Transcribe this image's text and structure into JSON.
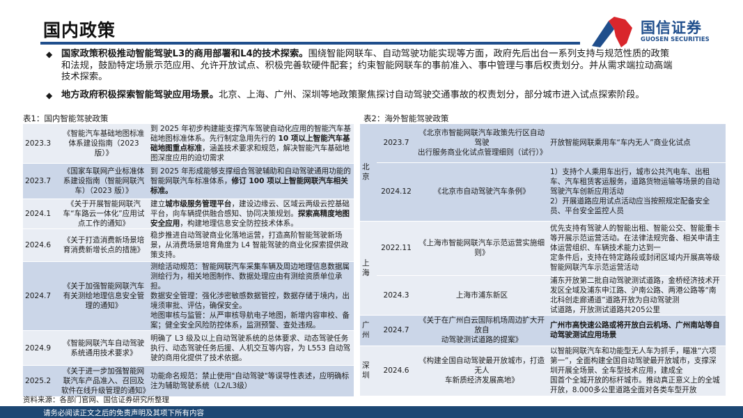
{
  "header": {
    "title": "国内政策",
    "logo_cn": "国信证券",
    "logo_en": "GUOSEN SECURITIES",
    "brand_blue": "#1f4e8c",
    "brand_red": "#d9262c"
  },
  "bullets": [
    {
      "bold": "国家政策积极推动智能驾驶L3的商用部署和L4的技术探索。",
      "text": "围绕智能网联车、自动驾驶功能实现等方面，政府先后出台一系列支持与规范性质的政策和法规，鼓励特定场景示范应用、允许开放试点、积极完善软硬件配套；约束智能网联车的事前准入、事中管理与事后权责划分。并从需求端拉动高端技术探索。"
    },
    {
      "bold": "地方政府积极探索智能驾驶应用场景。",
      "text": "北京、上海、广州、深圳等地政策聚焦探讨自动驾驶交通事故的权责划分，部分城市进入试点探索阶段。"
    }
  ],
  "table1": {
    "caption": "表1：国内智能驾驶政策",
    "rows": [
      {
        "date": "2023.3",
        "name": "《智能汽车基础地图标准体系建设指南（2023 版）》",
        "desc": [
          {
            "t": "到 2025 年初步构建能支撑汽车驾驶自动化应用的智能汽车基础地图标准体系。先行制定急用先行的 "
          },
          {
            "t": "10 项以上智能汽车基础地图重点标准",
            "b": true
          },
          {
            "t": "，涵盖技术要求和规范，解决智能汽车基础地图深度应用的迫切需求"
          }
        ]
      },
      {
        "date": "2023.7",
        "name": "《国家车联网产业标准体系建设指南（智能网联汽车）（2023 版）》",
        "desc": [
          {
            "t": "到 2025 年形成能够支撑组合驾驶辅助和自动驾驶通用功能的智能网联汽车标准体系，"
          },
          {
            "t": "修订 100 项以上智能网联汽车相关标准。",
            "b": true
          }
        ]
      },
      {
        "date": "2024.1",
        "name": "《关于开展智能网联汽车“车路云一体化”应用试点工作的通知》",
        "desc": [
          {
            "t": "建立"
          },
          {
            "t": "城市级服务管理平台",
            "b": true
          },
          {
            "t": "，建设边缘云、区域云两级云控基础平台，向车辆提供融合感知、协同决策规划。"
          },
          {
            "t": "探索高精度地图安全应用",
            "b": true
          },
          {
            "t": "，构建地理信息安全防控技术体系。"
          }
        ]
      },
      {
        "date": "2024.6",
        "name": "《关于打造消费新场景培育消费新增长点的措施》",
        "desc": [
          {
            "t": "稳步推进自动驾驶商业化落地运营，打造高阶智能驾驶新场景，从消费场景培育角度为 L4 智能驾驶的商业化探索提供政策支持。"
          }
        ]
      },
      {
        "date": "2024.7",
        "name": "《关于加强智能网联汽车有关测绘地理信息安全管理的通知》",
        "desc": [
          {
            "t": "测绘活动规范：智能网联汽车采集车辆及周边地理信息数据属测绘行为，相关地图制作、数据处理应由有测绘资质单位承担。\n数据安全管理：强化涉密敏感数据管控，数据存储于境内，出境须审批、评估，确保安全。\n地图审核与监管：从严审核导航电子地图，新增内容审校、备案；健全安全风险防控体系，监测预警、查处违规。"
          }
        ]
      },
      {
        "date": "2024.9",
        "name": "《智能网联汽车自动驾驶系统通用技术要求》",
        "desc": [
          {
            "t": "明确了 L3 级及以上自动驾驶系统的总体要求、动态驾驶任务执行、动态驾驶任务后援、人机交互等内容，为 L553 自动驾驶的商用化提供了技术依据。"
          }
        ]
      },
      {
        "date": "2025.2",
        "name": "《关于进一步加强智能网联汽车产品准入、召回及软件在线升级管理的通知》",
        "desc": [
          {
            "t": "功能命名规范：禁止使用\"自动驾驶\"等误导性表述，应明确标注为辅助驾驶系统（L2/L3级）"
          }
        ]
      }
    ],
    "source": "资料来源：各部门官网、国信证券研究所整理"
  },
  "table2": {
    "caption": "表2：海外智能驾驶政策",
    "groups": [
      {
        "city": "北京",
        "rows": [
          {
            "date": "2023.7",
            "name": "《北京市智能网联汽车政策先行区自动驾驶\n出行服务商业化试点管理细则（试行）》",
            "desc": [
              {
                "t": "开放智能网联乘用车“车内无人”商业化试点"
              }
            ]
          },
          {
            "date": "2024.12",
            "name": "《北京市自动驾驶汽车条例》",
            "desc": [
              {
                "t": "1）支持个人乘用车出行，城市公共汽电车、出租车、汽车租赁客运服务，道路货物运输等场景的自动驾驶汽车创新应用活动\n2）开展道路应用试点活动应当按照规定配备安全员、平台安全监控人员"
              }
            ]
          }
        ]
      },
      {
        "city": "上海",
        "rows": [
          {
            "date": "2022.11",
            "name": "《上海市智能网联汽车示范运营实施细则》",
            "desc": [
              {
                "t": "优先支持有驾驶人的智能出租、智能公交、智能重卡等开展示范运营活动。在法律法规完备、相关申请主体运营组织、车辆技术能力达到一\n定条件后，支持在特定路段或封闭区域内开展高等级智能网联汽车示范运营活动"
              }
            ]
          },
          {
            "date": "2024.3",
            "name": "上海市浦东新区",
            "desc": [
              {
                "t": "浦东开放第二批自动驾驶测试道路，金桥经济技术开发区全域及浦东申江路、沪南公路、两港公路等“南北科创走廊通道”道路开放为自动驾驶测\n试道路，开放测试道路共205公里"
              }
            ]
          }
        ]
      },
      {
        "city": "广州",
        "rows": [
          {
            "date": "2024.7",
            "name": "《关于在广州白云国际机场周边扩大开放自\n动驾驶测试道路的提案》",
            "desc": [
              {
                "t": "广州市高快速公路或将开放白云机场、广州南站等自动驾驶测试应用场景",
                "b": true
              }
            ]
          }
        ]
      },
      {
        "city": "深圳",
        "rows": [
          {
            "date": "2024.6",
            "name": "《构建全国自动驾驶最开放城市，打造无人\n车新质经济发展高地》",
            "desc": [
              {
                "t": "以智能网联汽车和功能型无人车为抓手，瞄准“六项第一”，全面构建全国自动驾驶最开放城市，支撑深圳开展全场景、全车型技术应用，建成全\n国首个全城开放的标杆城市。推动真正意义上的全城开放，8.000多公里道路全面对各类车型开放"
              }
            ]
          }
        ]
      }
    ]
  },
  "footer": {
    "disclaimer": "请务必阅读正文之后的免责声明及其项下所有内容"
  }
}
